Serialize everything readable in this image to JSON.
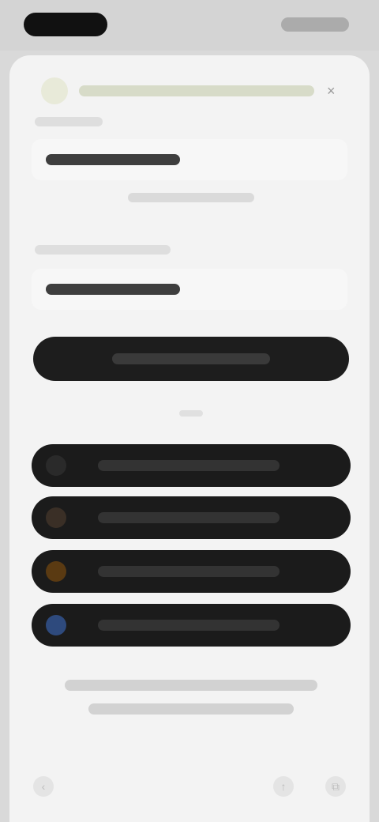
{
  "status_bar": {
    "time": "",
    "icons": [
      "signal-icon",
      "wifi-icon",
      "battery-icon"
    ]
  },
  "browser": {
    "url": "",
    "close_glyph": "×"
  },
  "form": {
    "email_label": "",
    "email_value": "",
    "helper_text": "",
    "password_label": "",
    "password_value": "",
    "continue_label": ""
  },
  "divider": {
    "label": ""
  },
  "social_buttons": [
    {
      "label": "",
      "icon": "apple-icon",
      "icon_color": "#2a2a2a"
    },
    {
      "label": "",
      "icon": "google-icon",
      "icon_color": "#3a2f26"
    },
    {
      "label": "",
      "icon": "amazon-icon",
      "icon_color": "#5a3a12"
    },
    {
      "label": "",
      "icon": "facebook-icon",
      "icon_color": "#2e4a7d"
    }
  ],
  "legal": {
    "line1": "",
    "line2": ""
  },
  "bottom_nav": {
    "back": "‹",
    "share": "↑",
    "tabs": "⧉"
  },
  "colors": {
    "background": "#f3f3f3",
    "button_dark": "#1d1d1d"
  }
}
